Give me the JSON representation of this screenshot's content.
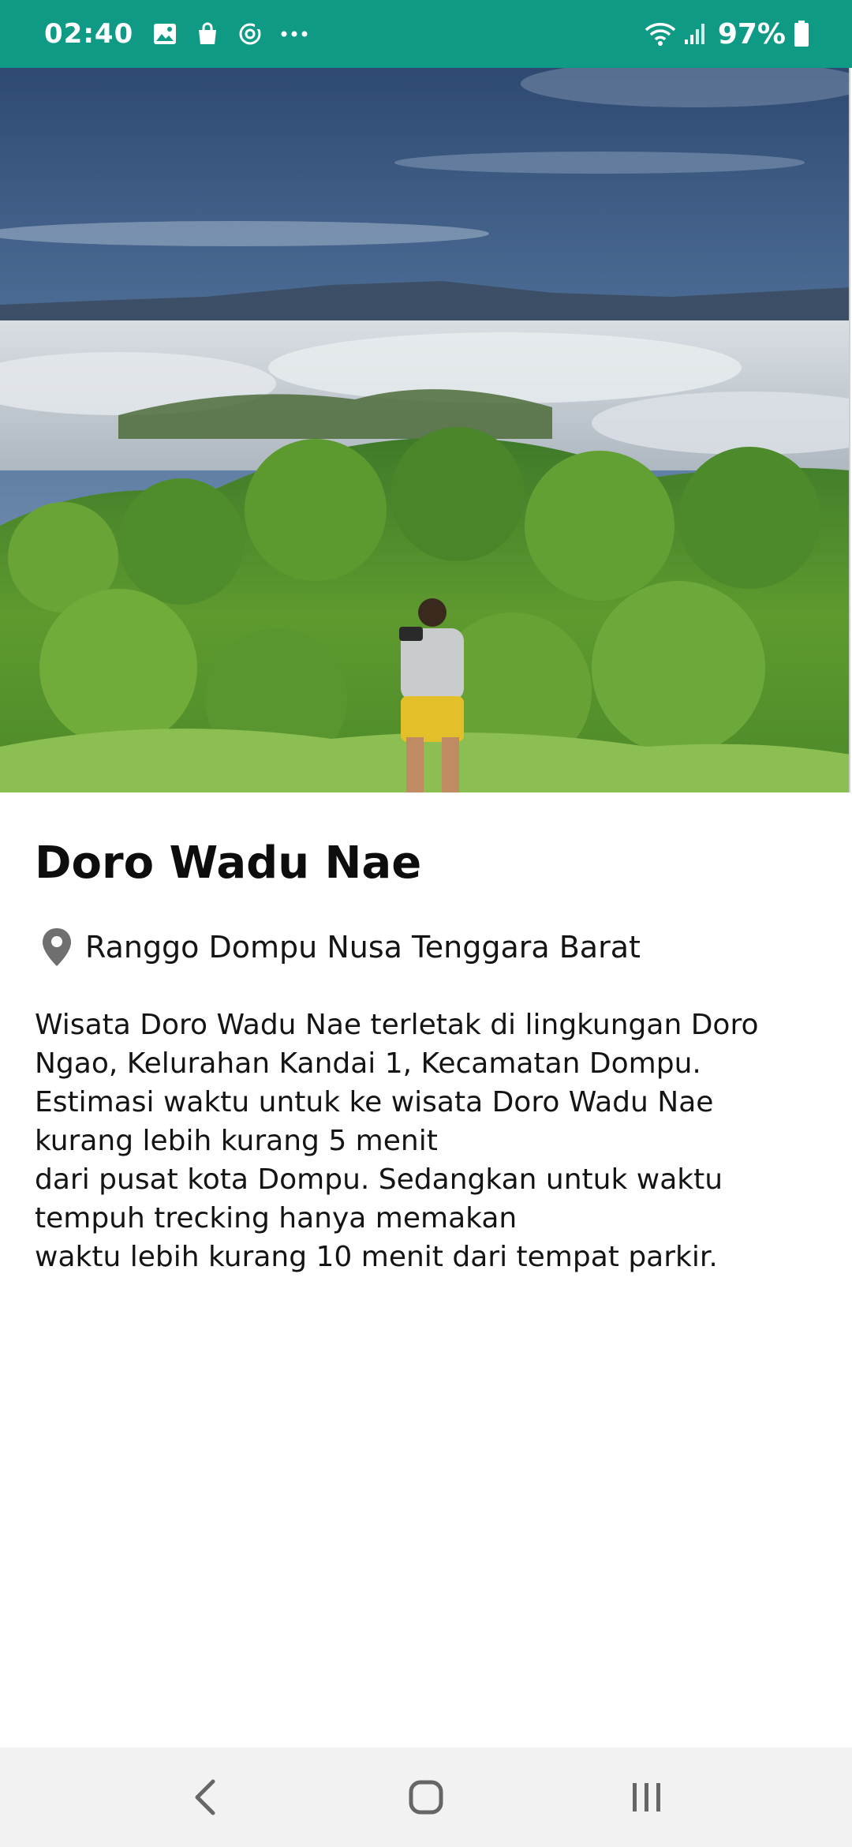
{
  "status_bar": {
    "time": "02:40",
    "battery": "97%",
    "notification_icons": [
      "gallery-icon",
      "shopping-bag-icon",
      "sync-icon",
      "more-dots-icon"
    ],
    "color": "#0f9a86"
  },
  "hero": {
    "image": "landscape-photo"
  },
  "place": {
    "title": "Doro Wadu Nae",
    "location": "Ranggo Dompu Nusa Tenggara Barat",
    "description": "Wisata Doro Wadu Nae terletak di lingkungan Doro\nNgao, Kelurahan Kandai 1, Kecamatan Dompu.\nEstimasi waktu untuk ke wisata Doro Wadu Nae\nkurang lebih kurang 5 menit\ndari pusat kota Dompu. Sedangkan untuk waktu\ntempuh trecking hanya memakan\nwaktu lebih kurang 10 menit dari tempat parkir."
  },
  "nav_bar": {
    "buttons": [
      "back",
      "home",
      "recents"
    ]
  }
}
